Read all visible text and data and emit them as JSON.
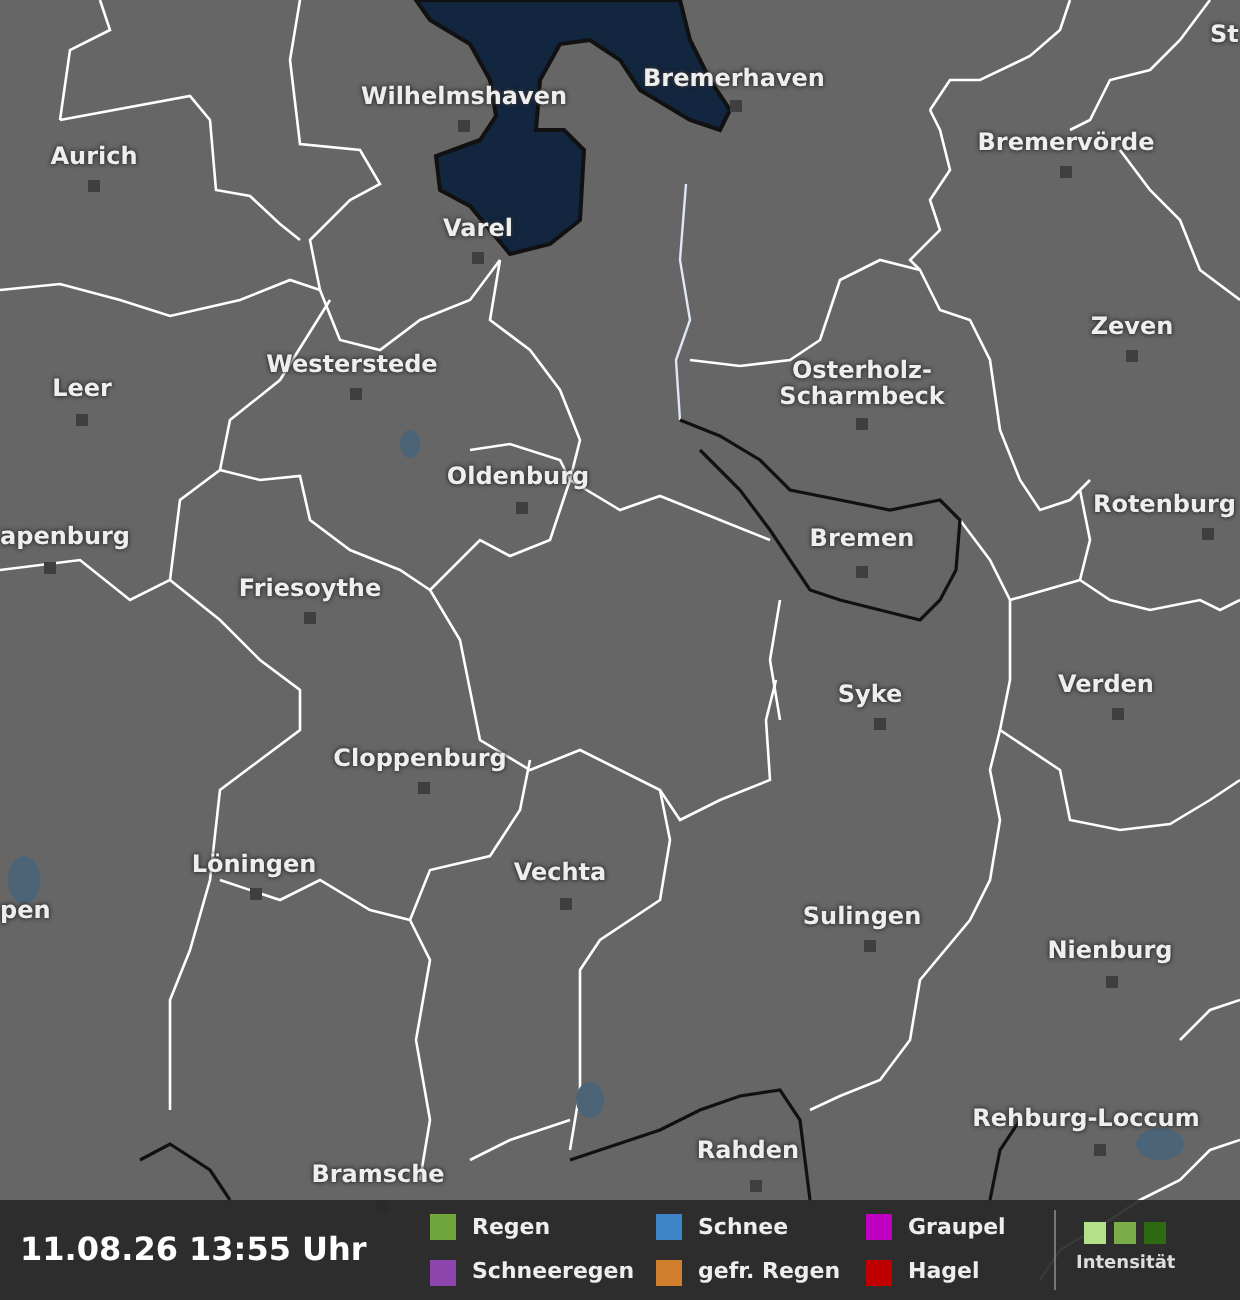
{
  "map": {
    "cities": [
      {
        "name": "St"
      },
      {
        "name": "Wilhelmshaven"
      },
      {
        "name": "Bremerhaven"
      },
      {
        "name": "Aurich"
      },
      {
        "name": "Bremervörde"
      },
      {
        "name": "Varel"
      },
      {
        "name": "Zeven"
      },
      {
        "name": "Westerstede"
      },
      {
        "name": "Leer"
      },
      {
        "name": "Osterholz-Scharmbeck"
      },
      {
        "name": "Oldenburg"
      },
      {
        "name": "Rotenburg"
      },
      {
        "name": "Bremen"
      },
      {
        "name": "apenburg"
      },
      {
        "name": "Friesoythe"
      },
      {
        "name": "Verden"
      },
      {
        "name": "Syke"
      },
      {
        "name": "Cloppenburg"
      },
      {
        "name": "Löningen"
      },
      {
        "name": "Vechta"
      },
      {
        "name": "pen"
      },
      {
        "name": "Sulingen"
      },
      {
        "name": "Nienburg"
      },
      {
        "name": "Rehburg-Loccum"
      },
      {
        "name": "Rahden"
      },
      {
        "name": "Bramsche"
      }
    ]
  },
  "legend": {
    "timestamp": "11.08.26 13:55 Uhr",
    "types": [
      {
        "label": "Regen",
        "color": "#6fa53a"
      },
      {
        "label": "Schneeregen",
        "color": "#8e44ad"
      },
      {
        "label": "Schnee",
        "color": "#3d85c6"
      },
      {
        "label": "gefr. Regen",
        "color": "#d07f2c"
      },
      {
        "label": "Graupel",
        "color": "#c000c0"
      },
      {
        "label": "Hagel",
        "color": "#c00000"
      }
    ],
    "intensity": {
      "label": "Intensität",
      "steps": [
        {
          "color": "#b5e08a"
        },
        {
          "color": "#7aad48"
        },
        {
          "color": "#2e6b10"
        }
      ]
    }
  }
}
